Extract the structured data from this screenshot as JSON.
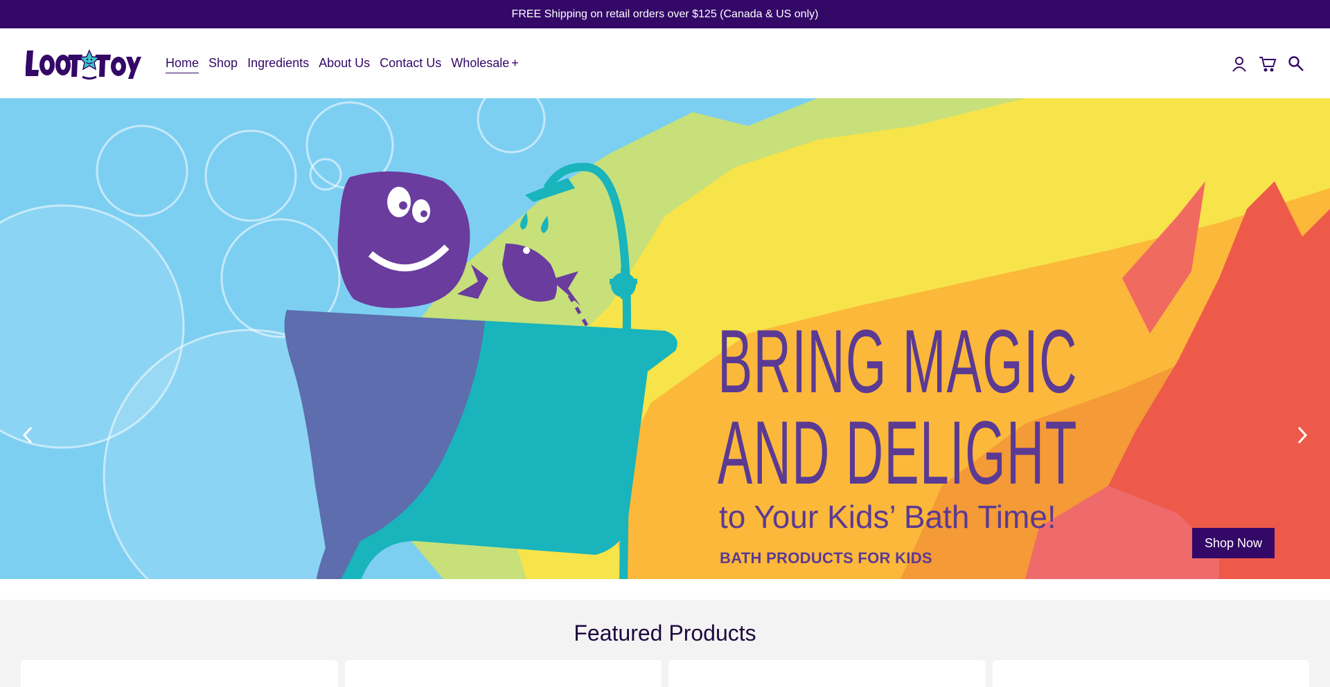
{
  "announcement": {
    "text": "FREE Shipping on retail orders over $125 (Canada & US only)"
  },
  "header": {
    "logo_text": "LOOT TOY",
    "nav": [
      {
        "label": "Home",
        "active": true
      },
      {
        "label": "Shop"
      },
      {
        "label": "Ingredients"
      },
      {
        "label": "About Us"
      },
      {
        "label": "Contact Us"
      },
      {
        "label": "Wholesale",
        "expandable": true
      }
    ],
    "icons": [
      "account-icon",
      "cart-icon",
      "search-icon"
    ]
  },
  "hero": {
    "headline_line1": "BRING MAGIC",
    "headline_line2": "AND DELIGHT",
    "subheadline": "to Your Kids’ Bath Time!",
    "category": "BATH PRODUCTS FOR KIDS",
    "cta_label": "Shop Now"
  },
  "featured": {
    "title": "Featured Products",
    "card_count": 4
  },
  "colors": {
    "brand": "#330867",
    "hero_sky": "#7dcff2",
    "headline": "#5b3a93"
  }
}
